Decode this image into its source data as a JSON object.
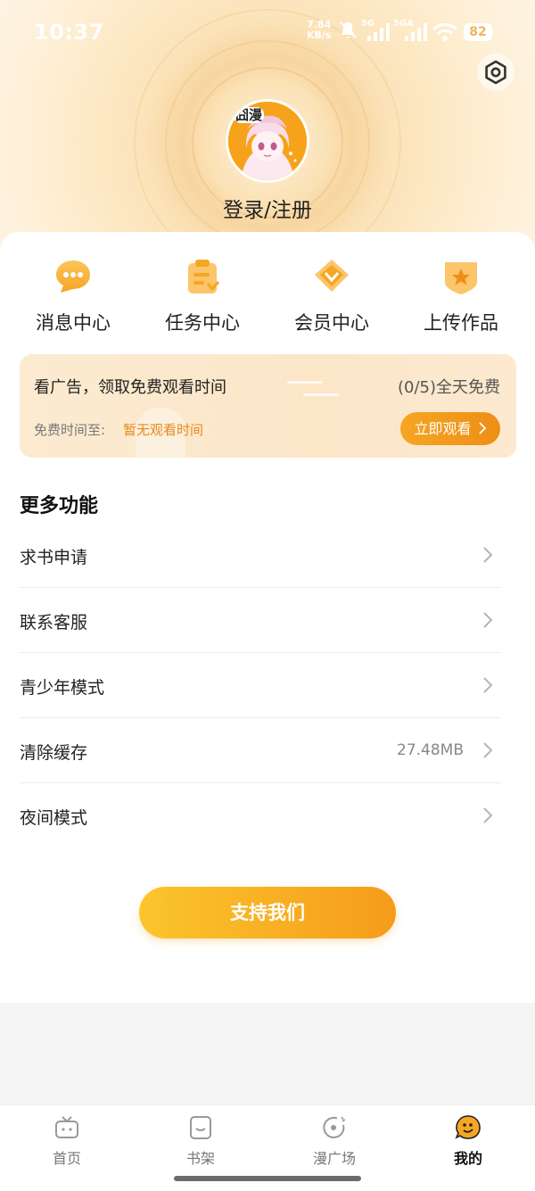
{
  "status_bar": {
    "time": "10:37",
    "net_speed_value": "7.84",
    "net_speed_unit": "KB/s",
    "sim1_label": "5G",
    "sim2_label": "5GA",
    "battery": "82"
  },
  "profile": {
    "avatar_badge": "囧漫",
    "login_label": "登录/注册"
  },
  "quick_actions": [
    {
      "label": "消息中心",
      "icon": "message-icon"
    },
    {
      "label": "任务中心",
      "icon": "task-icon"
    },
    {
      "label": "会员中心",
      "icon": "vip-diamond-icon"
    },
    {
      "label": "上传作品",
      "icon": "upload-star-icon"
    }
  ],
  "ad_card": {
    "title": "看广告，领取免费观看时间",
    "count": "(0/5)全天免费",
    "free_time_label": "免费时间至:",
    "free_time_value": "暂无观看时间",
    "button_label": "立即观看"
  },
  "more": {
    "title": "更多功能",
    "items": [
      {
        "label": "求书申请",
        "value": ""
      },
      {
        "label": "联系客服",
        "value": ""
      },
      {
        "label": "青少年模式",
        "value": ""
      },
      {
        "label": "清除缓存",
        "value": "27.48MB"
      },
      {
        "label": "夜间模式",
        "value": ""
      }
    ]
  },
  "support_button": "支持我们",
  "tabbar": {
    "items": [
      {
        "label": "首页",
        "icon": "home-tv-icon"
      },
      {
        "label": "书架",
        "icon": "bookshelf-icon"
      },
      {
        "label": "漫广场",
        "icon": "plaza-icon"
      },
      {
        "label": "我的",
        "icon": "profile-face-icon"
      }
    ],
    "active": "我的"
  },
  "colors": {
    "accent": "#f5a623",
    "accent_dark": "#ee8e15",
    "header_bg": "#fbe1b4",
    "card_bg": "#fcebd1"
  }
}
